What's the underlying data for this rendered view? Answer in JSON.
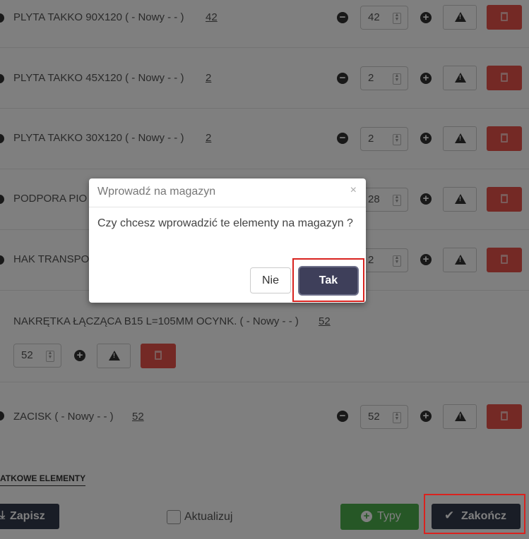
{
  "rows": [
    {
      "label": "PLYTA TAKKO 90X120 ( - Nowy - - )",
      "qty_link": "42",
      "qty_value": "42"
    },
    {
      "label": "PLYTA TAKKO 45X120 ( - Nowy - - )",
      "qty_link": "2",
      "qty_value": "2"
    },
    {
      "label": "PLYTA TAKKO 30X120 ( - Nowy - - )",
      "qty_link": "2",
      "qty_value": "2"
    },
    {
      "label": "PODPORA PIO",
      "qty_value": "28"
    },
    {
      "label": "HAK TRANSPO",
      "qty_value": "2"
    },
    {
      "label": "NAKRĘTKA ŁĄCZĄCA B15 L=105MM OCYNK. ( - Nowy - - )",
      "qty_link": "52",
      "qty_value": "52"
    },
    {
      "label": "ZACISK ( - Nowy - - )",
      "qty_link": "52",
      "qty_value": "52"
    }
  ],
  "footer": {
    "section_title": "ATKOWE ELEMENTY",
    "save_label": "Zapisz",
    "update_label": "Aktualizuj",
    "types_label": "Typy",
    "finish_label": "Zakończ"
  },
  "modal": {
    "title": "Wprowadź na magazyn",
    "close": "×",
    "message": "Czy chcesz wprowadzić te elementy na magazyn ?",
    "no_label": "Nie",
    "yes_label": "Tak"
  },
  "colors": {
    "danger": "#e8534a",
    "success": "#4cae4c",
    "dark": "#333a4d",
    "highlight": "#d9231f"
  }
}
